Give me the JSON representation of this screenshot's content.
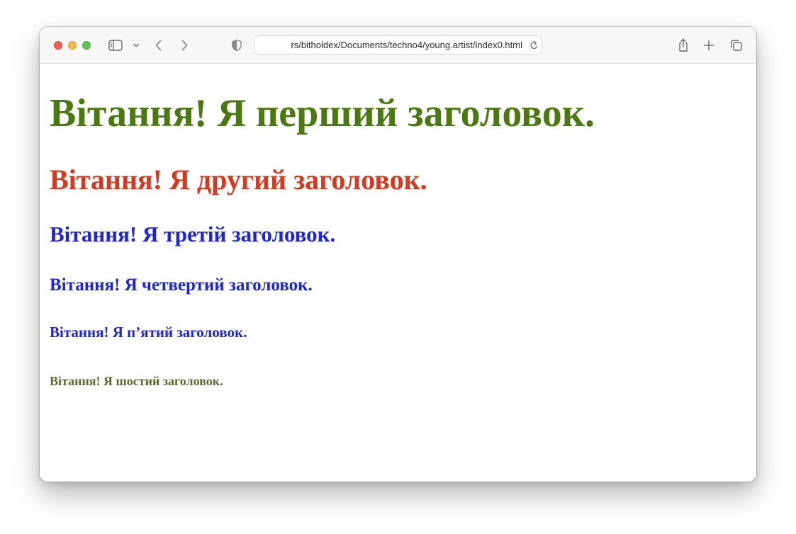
{
  "browser": {
    "url": "rs/bitholdex/Documents/techno4/young.artist/index0.html",
    "icons": {
      "sidebar": "sidebar-icon",
      "tab_overview_menu": "chevron-down-icon",
      "back": "chevron-left-icon",
      "forward": "chevron-right-icon",
      "privacy": "shield-icon",
      "reload": "reload-icon",
      "share": "share-icon",
      "new_tab": "plus-icon",
      "tab_overview": "tabs-icon"
    }
  },
  "page": {
    "headings": [
      {
        "level": 1,
        "text": "Вітання! Я перший заголовок.",
        "color": "#4a7a0f"
      },
      {
        "level": 2,
        "text": "Вітання! Я другий заголовок.",
        "color": "#d8381d"
      },
      {
        "level": 3,
        "text": "Вітання! Я третій заголовок.",
        "color": "#1c24e0"
      },
      {
        "level": 4,
        "text": "Вітання! Я четвертий заголовок.",
        "color": "#1c24e0"
      },
      {
        "level": 5,
        "text": "Вітання! Я п’ятий заголовок.",
        "color": "#1c24e0"
      },
      {
        "level": 6,
        "text": "Вітання! Я шостий заголовок.",
        "color": "#5a6a2c"
      }
    ]
  }
}
